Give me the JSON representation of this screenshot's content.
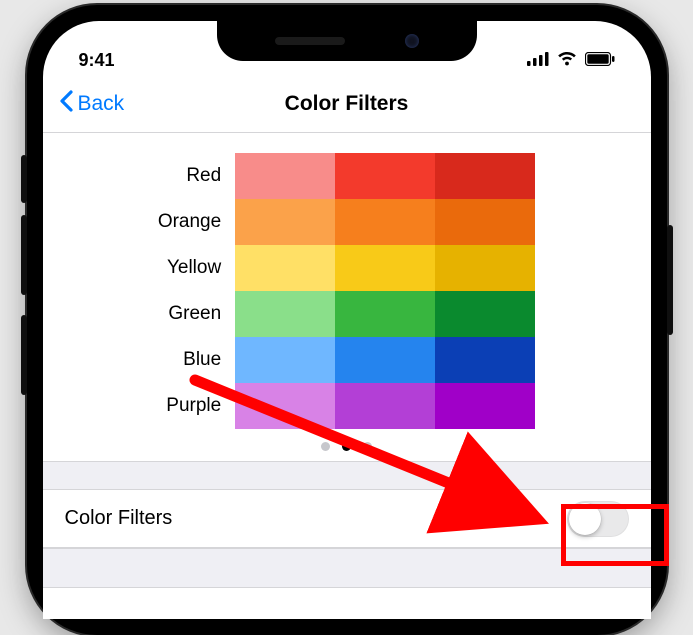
{
  "status": {
    "time": "9:41"
  },
  "nav": {
    "back_label": "Back",
    "title": "Color Filters"
  },
  "swatches": {
    "names": [
      "Red",
      "Orange",
      "Yellow",
      "Green",
      "Blue",
      "Purple"
    ],
    "grid": [
      [
        "#f88c8a",
        "#f33a2c",
        "#d8291c"
      ],
      [
        "#fba24a",
        "#f67f1d",
        "#ea6a0c"
      ],
      [
        "#ffe066",
        "#f8ca18",
        "#e6b200"
      ],
      [
        "#8adf8a",
        "#38b63f",
        "#0a8a2e"
      ],
      [
        "#6fb7ff",
        "#2584ee",
        "#0b3fb5"
      ],
      [
        "#d882e6",
        "#b33fd6",
        "#a000c8"
      ]
    ],
    "page_index": 1,
    "page_count": 3
  },
  "setting_row": {
    "label": "Color Filters",
    "enabled": false
  }
}
